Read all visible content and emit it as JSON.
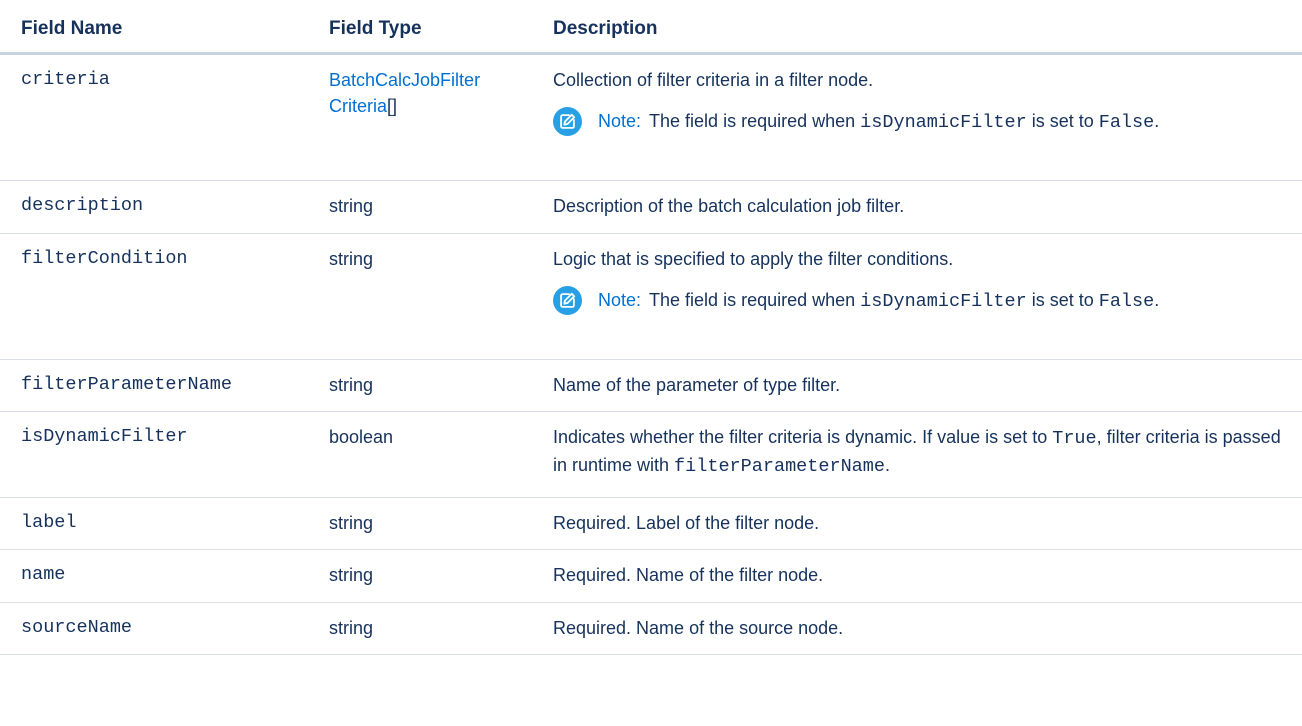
{
  "headers": {
    "field_name": "Field Name",
    "field_type": "Field Type",
    "description": "Description"
  },
  "rows": [
    {
      "name": "criteria",
      "type_link_part1": "BatchCalcJobFilter",
      "type_link_part2": "Criteria",
      "type_suffix": "[]",
      "description": "Collection of filter criteria in a filter node.",
      "note": {
        "label": "Note:",
        "text_before": "The field is required when ",
        "code1": "isDynamicFilter",
        "text_middle": " is set to ",
        "code2": "False",
        "text_after": "."
      }
    },
    {
      "name": "description",
      "type": "string",
      "description": "Description of the batch calculation job filter."
    },
    {
      "name": "filterCondition",
      "type": "string",
      "description": "Logic that is specified to apply the filter conditions.",
      "note": {
        "label": "Note:",
        "text_before": "The field is required when ",
        "code1": "isDynamicFilter",
        "text_middle": " is set to ",
        "code2": "False",
        "text_after": "."
      }
    },
    {
      "name": "filterParameterName",
      "type": "string",
      "description": "Name of the parameter of type filter."
    },
    {
      "name": "isDynamicFilter",
      "type": "boolean",
      "description_part1": "Indicates whether the filter criteria is dynamic. If value is set to ",
      "description_code1": "True",
      "description_part2": ", filter criteria is passed in runtime with ",
      "description_code2": "filterParameterName",
      "description_part3": "."
    },
    {
      "name": "label",
      "type": "string",
      "description": "Required. Label of the filter node."
    },
    {
      "name": "name",
      "type": "string",
      "description": "Required. Name of the filter node."
    },
    {
      "name": "sourceName",
      "type": "string",
      "description": "Required. Name of the source node."
    }
  ],
  "icons": {
    "note": "edit-note-icon"
  },
  "colors": {
    "text": "#16325c",
    "link": "#0070d2",
    "note_icon_bg": "#27a0e6",
    "header_rule": "#c9d3df",
    "row_rule": "#d8dde6"
  }
}
